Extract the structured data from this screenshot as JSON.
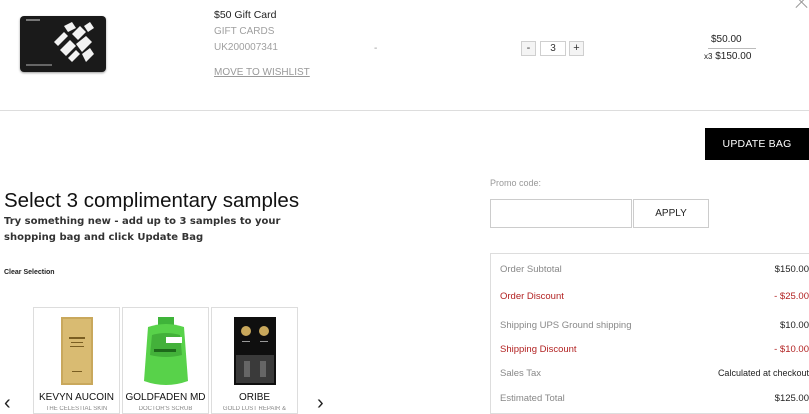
{
  "cart_item": {
    "name": "$50 Gift Card",
    "category": "GIFT CARDS",
    "sku": "UK200007341",
    "wishlist_link": "MOVE TO WISHLIST",
    "placeholder_dash": "-",
    "quantity": "3",
    "qty_minus": "-",
    "qty_plus": "+",
    "unit_price": "$50.00",
    "line_multiplier": "x3",
    "line_total": "$150.00"
  },
  "actions": {
    "update_bag": "UPDATE BAG"
  },
  "samples": {
    "title": "Select 3 complimentary samples",
    "subtitle": "Try something new - add up to 3 samples to your shopping bag and click Update Bag",
    "clear_selection": "Clear Selection",
    "prev_arrow": "‹",
    "next_arrow": "›",
    "items": [
      {
        "brand": "KEVYN AUCOIN",
        "product": "THE CELESTIAL SKIN"
      },
      {
        "brand": "GOLDFADEN MD",
        "product": "DOCTOR'S SCRUB"
      },
      {
        "brand": "ORIBE",
        "product": "GOLD LUST REPAIR &"
      }
    ]
  },
  "promo": {
    "label": "Promo code:",
    "input_value": "",
    "apply_label": "APPLY"
  },
  "summary": {
    "rows": [
      {
        "label": "Order Subtotal",
        "value": "$150.00"
      },
      {
        "label": "Order Discount",
        "value": "- $25.00"
      },
      {
        "label": "Shipping UPS Ground shipping",
        "value": "$10.00"
      },
      {
        "label": "Shipping Discount",
        "value": "- $10.00"
      },
      {
        "label": "Sales Tax",
        "value": "Calculated at checkout"
      },
      {
        "label": "Estimated Total",
        "value": "$125.00"
      }
    ]
  },
  "colors": {
    "discount_red": "#b22222",
    "button_black": "#000000",
    "muted_gray": "#888888"
  },
  "icons": {
    "close": "close-icon",
    "prev": "chevron-left-icon",
    "next": "chevron-right-icon"
  }
}
